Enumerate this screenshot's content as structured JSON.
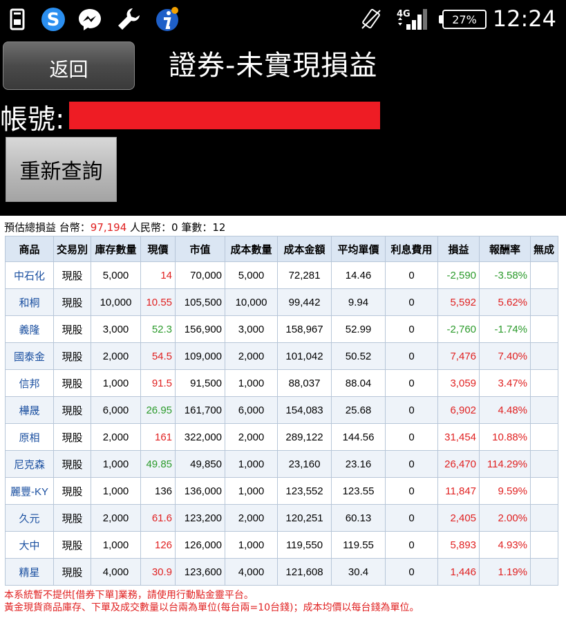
{
  "statusbar": {
    "time": "12:24",
    "battery": "27%",
    "network": "4G"
  },
  "header": {
    "back_label": "返回",
    "title": "證券-未實現損益",
    "account_label": "帳號:",
    "requery_label": "重新查詢"
  },
  "summary": {
    "prefix": "預估總損益 台幣：",
    "twd_total": "97,194",
    "rmb_part": " 人民幣：0 筆數：12"
  },
  "table": {
    "columns": [
      "商品",
      "交易別",
      "庫存數量",
      "現價",
      "市值",
      "成本數量",
      "成本金額",
      "平均單價",
      "利息費用",
      "損益",
      "報酬率",
      "無成"
    ],
    "rows": [
      {
        "name": "中石化",
        "type": "現股",
        "qty": "5,000",
        "price": "14",
        "mv": "70,000",
        "cqty": "5,000",
        "camt": "72,281",
        "avg": "14.46",
        "interest": "0",
        "pl": "-2,590",
        "roi": "-3.58%",
        "pc": "red",
        "plc": "green"
      },
      {
        "name": "和桐",
        "type": "現股",
        "qty": "10,000",
        "price": "10.55",
        "mv": "105,500",
        "cqty": "10,000",
        "camt": "99,442",
        "avg": "9.94",
        "interest": "0",
        "pl": "5,592",
        "roi": "5.62%",
        "pc": "red",
        "plc": "red"
      },
      {
        "name": "義隆",
        "type": "現股",
        "qty": "3,000",
        "price": "52.3",
        "mv": "156,900",
        "cqty": "3,000",
        "camt": "158,967",
        "avg": "52.99",
        "interest": "0",
        "pl": "-2,760",
        "roi": "-1.74%",
        "pc": "green",
        "plc": "green"
      },
      {
        "name": "國泰金",
        "type": "現股",
        "qty": "2,000",
        "price": "54.5",
        "mv": "109,000",
        "cqty": "2,000",
        "camt": "101,042",
        "avg": "50.52",
        "interest": "0",
        "pl": "7,476",
        "roi": "7.40%",
        "pc": "red",
        "plc": "red"
      },
      {
        "name": "信邦",
        "type": "現股",
        "qty": "1,000",
        "price": "91.5",
        "mv": "91,500",
        "cqty": "1,000",
        "camt": "88,037",
        "avg": "88.04",
        "interest": "0",
        "pl": "3,059",
        "roi": "3.47%",
        "pc": "red",
        "plc": "red"
      },
      {
        "name": "樺晟",
        "type": "現股",
        "qty": "6,000",
        "price": "26.95",
        "mv": "161,700",
        "cqty": "6,000",
        "camt": "154,083",
        "avg": "25.68",
        "interest": "0",
        "pl": "6,902",
        "roi": "4.48%",
        "pc": "green",
        "plc": "red"
      },
      {
        "name": "原相",
        "type": "現股",
        "qty": "2,000",
        "price": "161",
        "mv": "322,000",
        "cqty": "2,000",
        "camt": "289,122",
        "avg": "144.56",
        "interest": "0",
        "pl": "31,454",
        "roi": "10.88%",
        "pc": "red",
        "plc": "red"
      },
      {
        "name": "尼克森",
        "type": "現股",
        "qty": "1,000",
        "price": "49.85",
        "mv": "49,850",
        "cqty": "1,000",
        "camt": "23,160",
        "avg": "23.16",
        "interest": "0",
        "pl": "26,470",
        "roi": "114.29%",
        "pc": "green",
        "plc": "red"
      },
      {
        "name": "麗豐-KY",
        "type": "現股",
        "qty": "1,000",
        "price": "136",
        "mv": "136,000",
        "cqty": "1,000",
        "camt": "123,552",
        "avg": "123.55",
        "interest": "0",
        "pl": "11,847",
        "roi": "9.59%",
        "pc": "black",
        "plc": "red"
      },
      {
        "name": "久元",
        "type": "現股",
        "qty": "2,000",
        "price": "61.6",
        "mv": "123,200",
        "cqty": "2,000",
        "camt": "120,251",
        "avg": "60.13",
        "interest": "0",
        "pl": "2,405",
        "roi": "2.00%",
        "pc": "red",
        "plc": "red"
      },
      {
        "name": "大中",
        "type": "現股",
        "qty": "1,000",
        "price": "126",
        "mv": "126,000",
        "cqty": "1,000",
        "camt": "119,550",
        "avg": "119.55",
        "interest": "0",
        "pl": "5,893",
        "roi": "4.93%",
        "pc": "red",
        "plc": "red"
      },
      {
        "name": "精星",
        "type": "現股",
        "qty": "4,000",
        "price": "30.9",
        "mv": "123,600",
        "cqty": "4,000",
        "camt": "121,608",
        "avg": "30.4",
        "interest": "0",
        "pl": "1,446",
        "roi": "1.19%",
        "pc": "red",
        "plc": "red"
      }
    ]
  },
  "notes": {
    "line1": "本系統暫不提供[借券下單]業務，請使用行動點金靈平台。",
    "line2": "黃金現貨商品庫存、下單及成交數量以台兩為單位(每台兩=10台錢)；成本均價以每台錢為單位。"
  },
  "colors": {
    "up": "#e02020",
    "down": "#2a9a2a",
    "name": "#1a4fa0",
    "header_bg": "#dbe6f3"
  },
  "icons": [
    "sim-card-icon",
    "skype-icon",
    "messenger-icon",
    "wrench-icon",
    "info-app-icon",
    "vibrate-icon",
    "signal-4g-icon",
    "battery-icon"
  ]
}
